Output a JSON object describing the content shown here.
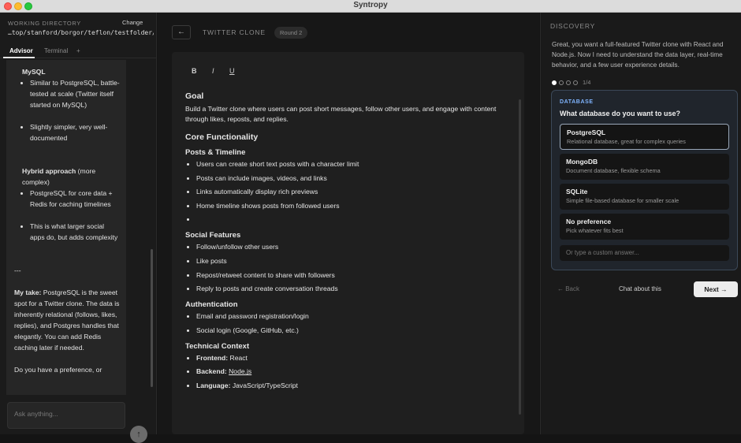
{
  "window": {
    "title": "Syntropy"
  },
  "sidebar": {
    "working_directory_label": "WORKING DIRECTORY",
    "change_label": "Change",
    "path": "…top/stanford/borgor/teflon/testfolder/",
    "tabs": [
      "Advisor",
      "Terminal",
      "+"
    ],
    "chat": {
      "mysql_title": "MySQL",
      "mysql_bullet1": "Similar to PostgreSQL, battle-tested at scale (Twitter itself started on MySQL)",
      "mysql_bullet2": "Slightly simpler, very well-documented",
      "hybrid_title": "Hybrid approach",
      "hybrid_suffix": " (more complex)",
      "hybrid_bullet1": "PostgreSQL for core data + Redis for caching timelines",
      "hybrid_bullet2": "This is what larger social apps do, but adds complexity",
      "separator": "---",
      "take_label": "My take:",
      "take_text": " PostgreSQL is the sweet spot for a Twitter clone. The data is inherently relational (follows, likes, replies), and Postgres handles that elegantly. You can add Redis caching later if needed.",
      "question": "Do you have a preference, or"
    },
    "input_placeholder": "Ask anything...",
    "send_icon": "↑"
  },
  "doc": {
    "back_icon": "←",
    "title": "TWITTER CLONE",
    "round": "Round 2",
    "toolbar": {
      "bold": "B",
      "italic": "I",
      "underline": "U"
    },
    "goal_heading": "Goal",
    "goal_text": "Build a Twitter clone where users can post short messages, follow other users, and engage with content through likes, reposts, and replies.",
    "core_heading": "Core Functionality",
    "posts_heading": "Posts & Timeline",
    "posts_items": [
      "Users can create short text posts with a character limit",
      "Posts can include images, videos, and links",
      "Links automatically display rich previews",
      "Home timeline shows posts from followed users",
      ""
    ],
    "social_heading": "Social Features",
    "social_items": [
      "Follow/unfollow other users",
      "Like posts",
      "Repost/retweet content to share with followers",
      "Reply to posts and create conversation threads"
    ],
    "auth_heading": "Authentication",
    "auth_items": [
      "Email and password registration/login",
      "Social login (Google, GitHub, etc.)"
    ],
    "tech_heading": "Technical Context",
    "tech_items": [
      {
        "label": "Frontend:",
        "value": "React"
      },
      {
        "label": "Backend:",
        "value": "Node.js"
      },
      {
        "label": "Language:",
        "value": "JavaScript/TypeScript"
      }
    ]
  },
  "discovery": {
    "title": "DISCOVERY",
    "intro": "Great, you want a full-featured Twitter clone with React and Node.js. Now I need to understand the data layer, real-time behavior, and a few user experience details.",
    "step": "1/4",
    "category": "DATABASE",
    "question": "What database do you want to use?",
    "options": [
      {
        "name": "PostgreSQL",
        "desc": "Relational database, great for complex queries"
      },
      {
        "name": "MongoDB",
        "desc": "Document database, flexible schema"
      },
      {
        "name": "SQLite",
        "desc": "Simple file-based database for smaller scale"
      },
      {
        "name": "No preference",
        "desc": "Pick whatever fits best"
      }
    ],
    "custom_placeholder": "Or type a custom answer...",
    "back_label": "← Back",
    "chat_label": "Chat about this",
    "next_label": "Next →"
  },
  "colors": {
    "accent": "#7fb4ff",
    "selected_border": "#9aa7b8"
  }
}
